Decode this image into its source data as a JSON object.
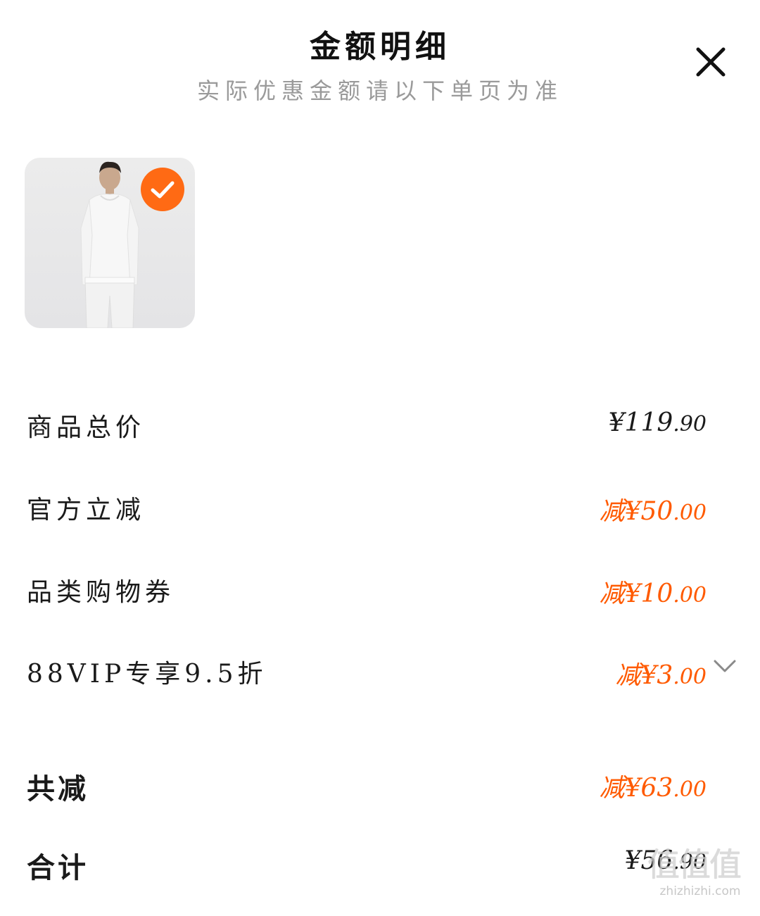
{
  "header": {
    "title": "金额明细",
    "subtitle": "实际优惠金额请以下单页为准",
    "close_icon": "close-icon"
  },
  "product": {
    "image_icon": "product-thumbnail",
    "selected": true,
    "badge_color": "#ff6a14"
  },
  "rows": [
    {
      "label": "商品总价",
      "prefix": "",
      "amount": "¥119",
      "cents": ".90",
      "tone": "dark"
    },
    {
      "label": "官方立减",
      "prefix": "减",
      "amount": "¥50",
      "cents": ".00",
      "tone": "orange"
    },
    {
      "label": "品类购物券",
      "prefix": "减",
      "amount": "¥10",
      "cents": ".00",
      "tone": "orange"
    },
    {
      "label": "88VIP专享9.5折",
      "prefix": "减",
      "amount": "¥3",
      "cents": ".00",
      "tone": "orange",
      "expand_icon": "chevron-down-icon"
    }
  ],
  "summary": {
    "total_discount": {
      "label": "共减",
      "prefix": "减",
      "amount": "¥63",
      "cents": ".00"
    },
    "total": {
      "label": "合计",
      "amount": "¥56",
      "cents": ".90"
    }
  },
  "watermark": {
    "glyphs": "值值值",
    "site": "zhizhizhi.com"
  },
  "colors": {
    "accent": "#ff5a00",
    "text": "#1a1a1a",
    "muted": "#9a9a9a"
  }
}
